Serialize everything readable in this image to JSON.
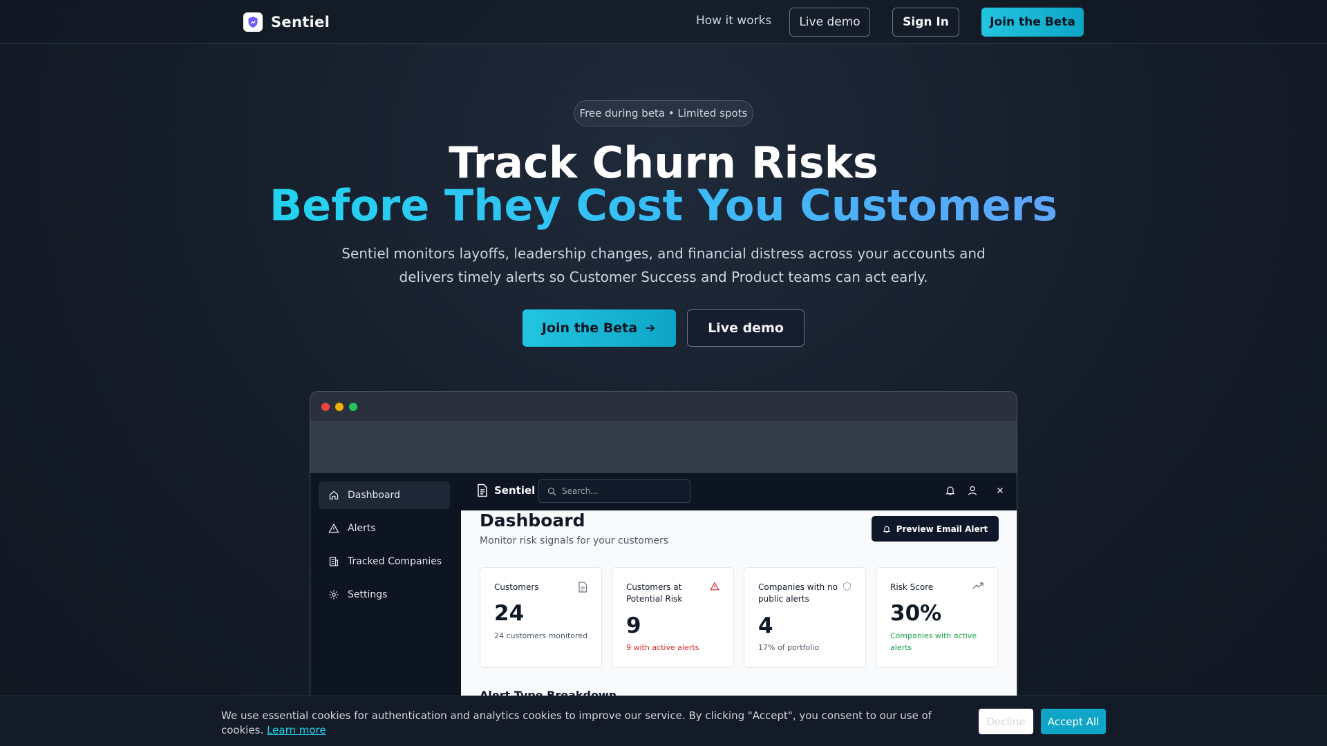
{
  "nav": {
    "brand": "Sentiel",
    "links": [
      "How it works"
    ],
    "live_demo": "Live demo",
    "sign_in": "Sign In",
    "join_beta": "Join the Beta"
  },
  "hero": {
    "badge": "Free during beta • Limited spots",
    "title_line1": "Track Churn Risks",
    "title_line2": "Before They Cost You Customers",
    "subtitle": "Sentiel monitors layoffs, leadership changes, and financial distress across your accounts and delivers timely alerts so Customer Success and Product teams can act early.",
    "cta_primary": "Join the Beta",
    "cta_secondary": "Live demo"
  },
  "mock_app": {
    "sidebar": {
      "items": [
        {
          "label": "Dashboard",
          "icon": "home-icon",
          "active": true
        },
        {
          "label": "Alerts",
          "icon": "warning-icon",
          "active": false
        },
        {
          "label": "Tracked Companies",
          "icon": "building-icon",
          "active": false
        },
        {
          "label": "Settings",
          "icon": "gear-icon",
          "active": false
        }
      ]
    },
    "topbar": {
      "brand": "Sentiel",
      "search_placeholder": "Search..."
    },
    "dashboard": {
      "title": "Dashboard",
      "subtitle": "Monitor risk signals for your customers",
      "preview_button": "Preview Email Alert",
      "cards": [
        {
          "label": "Customers",
          "value": "24",
          "note": "24 customers monitored",
          "icon": "document-icon"
        },
        {
          "label": "Customers at Potential Risk",
          "value": "9",
          "note": "9 with active alerts",
          "icon": "warning-icon"
        },
        {
          "label": "Companies with no public alerts",
          "value": "4",
          "note": "17% of portfolio",
          "icon": "shield-icon"
        },
        {
          "label": "Risk Score",
          "value": "30%",
          "note": "Companies with active alerts",
          "icon": "trending-up-icon"
        }
      ],
      "section_heading": "Alert Type Breakdown"
    }
  },
  "cookie": {
    "text": "We use essential cookies for authentication and analytics cookies to improve our service. By clicking \"Accept\", you consent to our use of cookies.",
    "link": "Learn more",
    "decline": "Decline",
    "accept": "Accept All"
  },
  "colors": {
    "accent": "#22c5e0",
    "background": "#141c28",
    "danger": "#dc2626",
    "success": "#16a34a"
  }
}
